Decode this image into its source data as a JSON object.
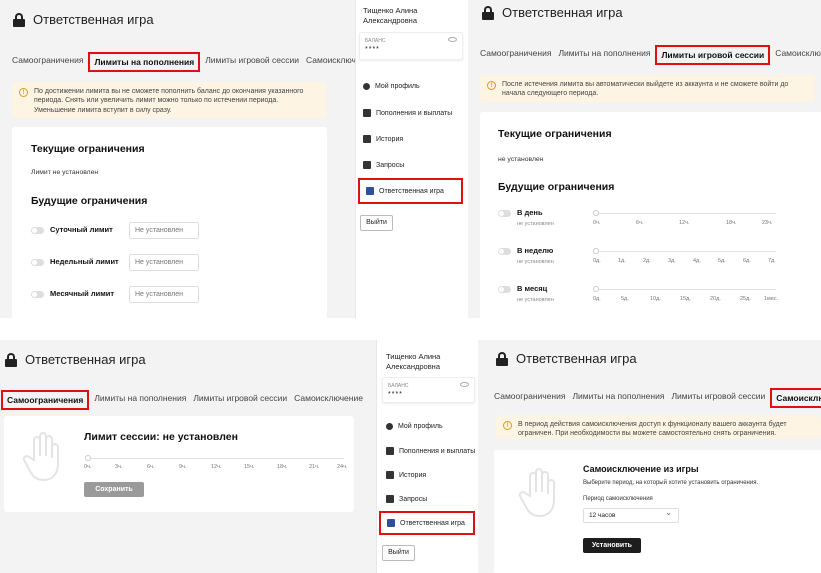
{
  "title": "Ответственная игра",
  "tabs": {
    "self_limits": "Самоограничения",
    "deposit_limits": "Лимиты на пополнения",
    "session_limits": "Лимиты игровой сессии",
    "self_exclusion": "Самоисключение"
  },
  "deposit_panel": {
    "warning": "По достижении лимита вы не сможете пополнить баланс до окончания указанного периода. Снять или увеличить лимит можно только по истечении периода. Уменьшение лимита вступит в силу сразу.",
    "current_heading": "Текущие ограничения",
    "current_value": "Лимит не установлен",
    "future_heading": "Будущие ограничения",
    "limits": [
      {
        "label": "Суточный лимит",
        "placeholder": "Не установлен"
      },
      {
        "label": "Недельный лимит",
        "placeholder": "Не установлен"
      },
      {
        "label": "Месячный лимит",
        "placeholder": "Не установлен"
      }
    ]
  },
  "sidebar": {
    "user_line1": "Тищенко Алина",
    "user_line2": "Александровна",
    "balance_label": "БАЛАНС",
    "balance_value": "****",
    "menu": [
      {
        "label": "Мой профиль",
        "icon": "user-icon"
      },
      {
        "label": "Пополнения и выплаты",
        "icon": "wallet-icon"
      },
      {
        "label": "История",
        "icon": "history-icon"
      },
      {
        "label": "Запросы",
        "icon": "chat-icon"
      },
      {
        "label": "Ответственная игра",
        "icon": "lock-icon"
      }
    ],
    "logout": "Выйти"
  },
  "session_panel": {
    "warning": "После истечения лимита вы автоматически выйдете из аккаунта и не сможете войти до начала следующего периода.",
    "current_heading": "Текущие ограничения",
    "current_value": "не установлен",
    "future_heading": "Будущие ограничения",
    "rows": [
      {
        "label": "В день",
        "sub": "не установлен",
        "ticks": [
          "0ч.",
          "6ч.",
          "12ч.",
          "18ч.",
          "23ч."
        ]
      },
      {
        "label": "В неделю",
        "sub": "не установлен",
        "ticks": [
          "0д.",
          "1д.",
          "2д.",
          "3д.",
          "4д.",
          "5д.",
          "6д.",
          "7д."
        ]
      },
      {
        "label": "В месяц",
        "sub": "не установлен",
        "ticks": [
          "0д.",
          "5д.",
          "10д.",
          "15д.",
          "20д.",
          "25д.",
          "1мес."
        ]
      }
    ]
  },
  "self_limits_panel": {
    "heading": "Лимит сессии: не установлен",
    "ticks": [
      "0ч.",
      "3ч.",
      "6ч.",
      "9ч.",
      "12ч.",
      "15ч.",
      "18ч.",
      "21ч.",
      "24ч."
    ],
    "save": "Сохранить"
  },
  "exclusion_panel": {
    "warning": "В период действия самоисключения доступ к функционалу вашего аккаунта будет ограничен. При необходимости вы можете самостоятельно снять ограничения.",
    "heading": "Самоисключение из игры",
    "description": "Выберите период, на который хотите установить ограничения.",
    "period_label": "Период самоисключения",
    "period_value": "12 часов",
    "submit": "Установить"
  },
  "colors": {
    "highlight": "#e01010",
    "warning_bg": "#fdf4e3",
    "warning_icon": "#e39a1c",
    "dark_button": "#1d1d1d"
  }
}
